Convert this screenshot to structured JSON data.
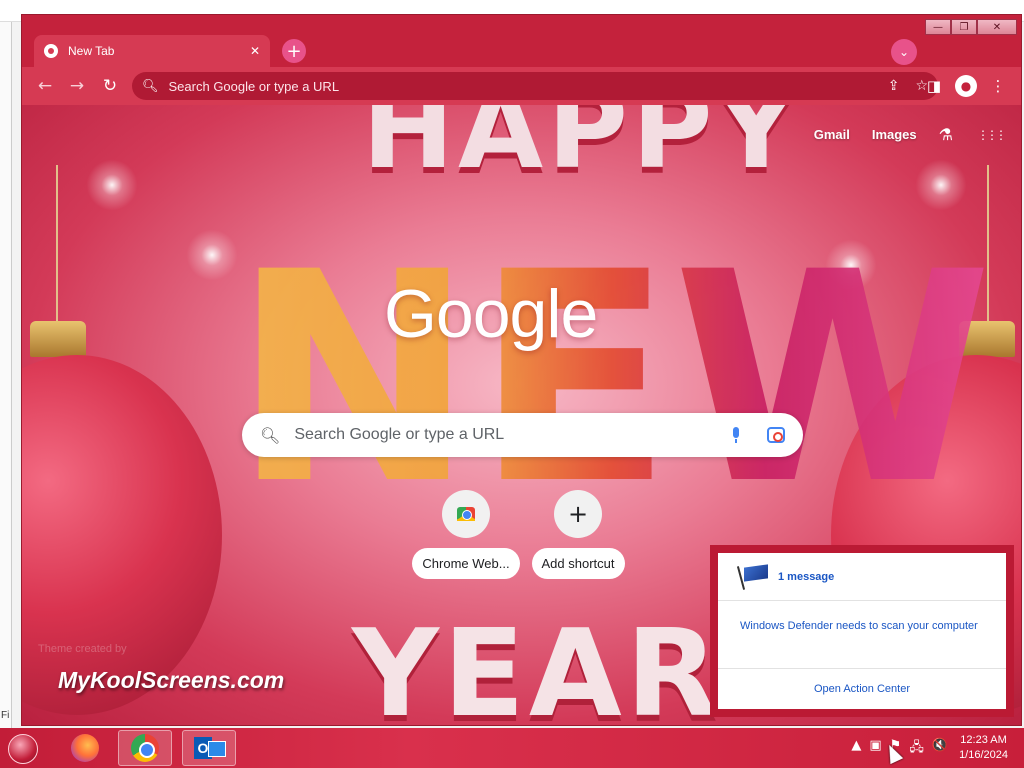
{
  "background_window": {
    "left_label": "Fi"
  },
  "chrome_window": {
    "controls": {
      "minimize": "—",
      "maximize": "❐",
      "close": "✕"
    },
    "tab": {
      "title": "New Tab",
      "close": "✕"
    },
    "new_tab": "+",
    "tab_search": "⌄",
    "toolbar": {
      "back": "←",
      "forward": "→",
      "reload": "↻",
      "omnibox_placeholder": "Search Google or type a URL",
      "share_icon": "⇪",
      "bookmark_icon": "☆",
      "sidepanel_icon": "◨",
      "profile_icon": "●",
      "menu_icon": "⋮"
    }
  },
  "newtab_page": {
    "top_links": {
      "gmail": "Gmail",
      "images": "Images"
    },
    "labs_icon": "⚗",
    "apps_icon": "⋮⋮⋮",
    "logo": "Google",
    "search": {
      "placeholder": "Search Google or type a URL"
    },
    "shortcuts": [
      {
        "label": "Chrome Web..."
      },
      {
        "label": "Add shortcut",
        "icon": "+"
      }
    ],
    "theme": {
      "decor_happy": "HAPPY",
      "decor_new": "NEW",
      "decor_year": "YEAR",
      "credit_small": "Theme created by",
      "credit": "MyKoolScreens.com"
    }
  },
  "notification": {
    "title": "1 message",
    "body": "Windows Defender needs to scan your computer",
    "action": "Open Action Center"
  },
  "taskbar": {
    "tray_icons": [
      "▲",
      "▣",
      "⚑",
      "🖧",
      "🔇"
    ],
    "time": "12:23 AM",
    "date": "1/16/2024"
  },
  "colors": {
    "theme_red": "#c4223c",
    "link_blue": "#1a56c4"
  }
}
